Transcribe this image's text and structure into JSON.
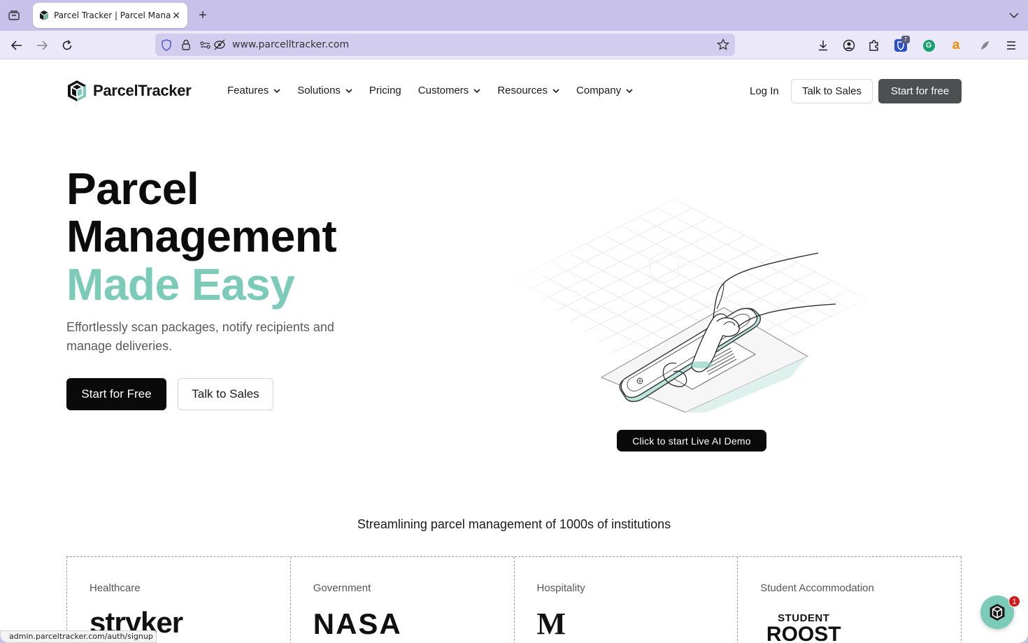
{
  "browser": {
    "tab_title": "Parcel Tracker | Parcel Managem",
    "url": "www.parcelltracker.com",
    "extension_badge": "7"
  },
  "header": {
    "logo_text": "ParcelTracker",
    "nav": [
      {
        "label": "Features"
      },
      {
        "label": "Solutions"
      },
      {
        "label": "Pricing"
      },
      {
        "label": "Customers"
      },
      {
        "label": "Resources"
      },
      {
        "label": "Company"
      }
    ],
    "login_label": "Log In",
    "talk_sales_label": "Talk to Sales",
    "start_free_label": "Start for free"
  },
  "hero": {
    "line1": "Parcel",
    "line2": "Management",
    "line3": "Made Easy",
    "subtitle": "Effortlessly scan packages, notify recipients and manage deliveries.",
    "start_free_label": "Start for Free",
    "talk_sales_label": "Talk to Sales",
    "demo_label": "Click to start Live AI Demo"
  },
  "institutions": {
    "heading": "Streamlining parcel management of 1000s of institutions",
    "categories": [
      {
        "label": "Healthcare",
        "logo": "stryker"
      },
      {
        "label": "Government",
        "logo": "NASA"
      },
      {
        "label": "Hospitality",
        "logo": "M"
      },
      {
        "label": "Student Accommodation",
        "logo_line1": "STUDENT",
        "logo_line2": "ROOST"
      }
    ]
  },
  "status_bar": {
    "url": "admin.parceltracker.com/auth/signup"
  },
  "chat": {
    "badge": "1"
  },
  "colors": {
    "accent_teal": "#7ccbb9",
    "browser_chrome": "#c8c2ea",
    "dark_button": "#4c5050"
  }
}
